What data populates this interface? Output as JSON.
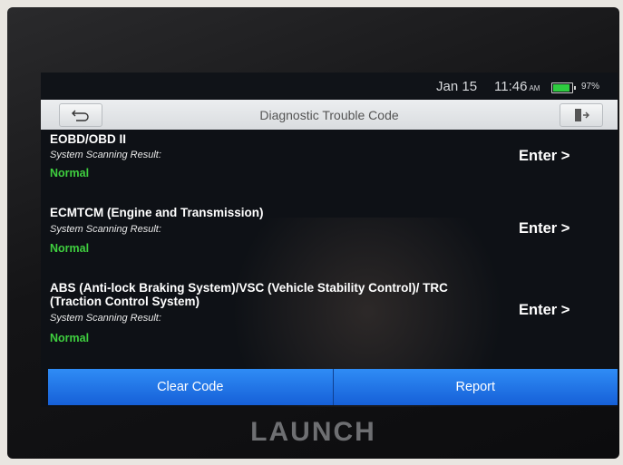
{
  "status": {
    "date": "Jan 15",
    "time": "11:46",
    "ampm": "AM",
    "battery": "97%",
    "battery_color": "#2ecc40"
  },
  "header": {
    "title": "Diagnostic Trouble Code",
    "back_icon": "back-arrow-icon",
    "exit_icon": "exit-icon"
  },
  "items": [
    {
      "title": "EOBD/OBD II",
      "subtitle": "System Scanning Result:",
      "status": "Normal",
      "action": "Enter >"
    },
    {
      "title": "ECMTCM (Engine and Transmission)",
      "subtitle": "System Scanning Result:",
      "status": "Normal",
      "action": "Enter >"
    },
    {
      "title": "ABS (Anti-lock Braking System)/VSC (Vehicle Stability Control)/ TRC (Traction Control System)",
      "subtitle": "System Scanning Result:",
      "status": "Normal",
      "action": "Enter >"
    }
  ],
  "footer": {
    "clear_code": "Clear Code",
    "report": "Report",
    "button_color": "#1a6ee6"
  },
  "brand": "LAUNCH"
}
